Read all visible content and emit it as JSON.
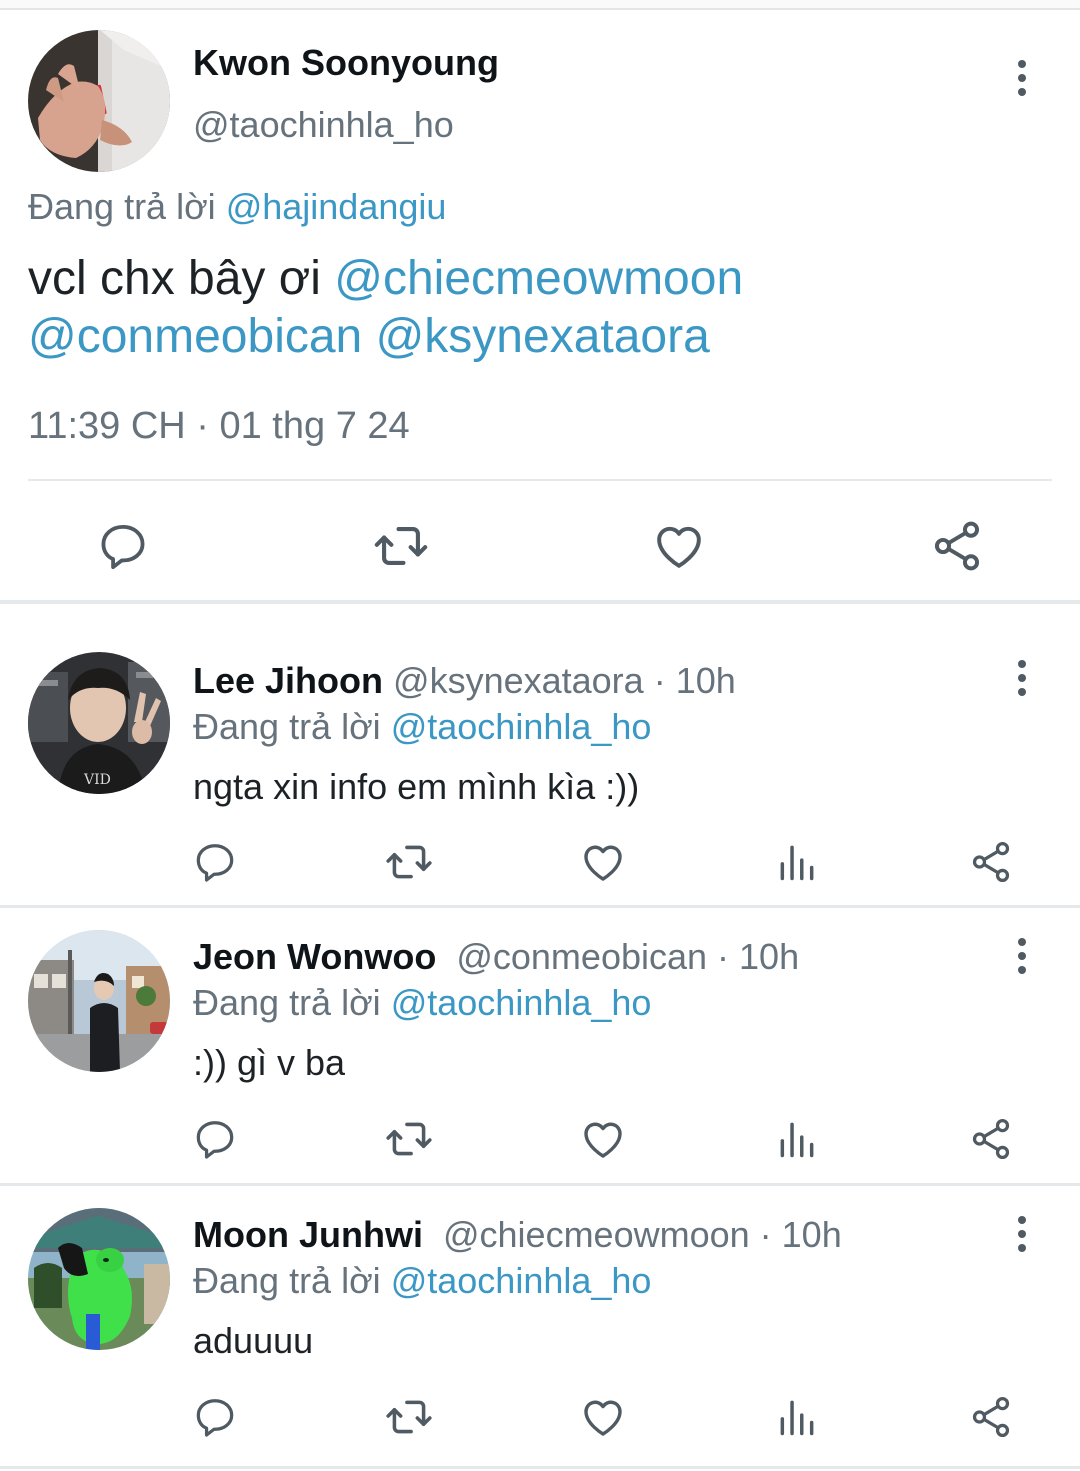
{
  "colors": {
    "link": "#3b97c4",
    "secondary_text": "#66727c",
    "icon": "#4f5a63",
    "divider": "#e6e9ec"
  },
  "main_tweet": {
    "author_name": "Kwon Soonyoung",
    "author_handle": "@taochinhla_ho",
    "replying_label": "Đang trả lời",
    "replying_to": "@hajindangiu",
    "text_plain": "vcl chx bây ơi",
    "text_mentions_line1": "@chiecmeowmoon",
    "text_mentions_line2": "@conmeobican @ksynexataora",
    "timestamp": "11:39 CH · 01 thg 7 24",
    "actions": [
      "reply-icon",
      "retweet-icon",
      "like-icon",
      "share-icon"
    ]
  },
  "replies": [
    {
      "author_name": "Lee Jihoon",
      "author_handle": "@ksynexataora",
      "time": " · 10h",
      "replying_label": "Đang trả lời",
      "replying_to": "@taochinhla_ho",
      "text": "ngta xin info em mình kìa :))"
    },
    {
      "author_name": "Jeon Wonwoo",
      "author_handle": "@conmeobican",
      "time": " · 10h",
      "replying_label": "Đang trả lời",
      "replying_to": "@taochinhla_ho",
      "text": ":)) gì v ba"
    },
    {
      "author_name": "Moon Junhwi",
      "author_handle": "@chiecmeowmoon",
      "time": " · 10h",
      "replying_label": "Đang trả lời",
      "replying_to": "@taochinhla_ho",
      "text": "aduuuu"
    }
  ],
  "reply_actions": [
    "reply-icon",
    "retweet-icon",
    "like-icon",
    "views-icon",
    "share-icon"
  ]
}
